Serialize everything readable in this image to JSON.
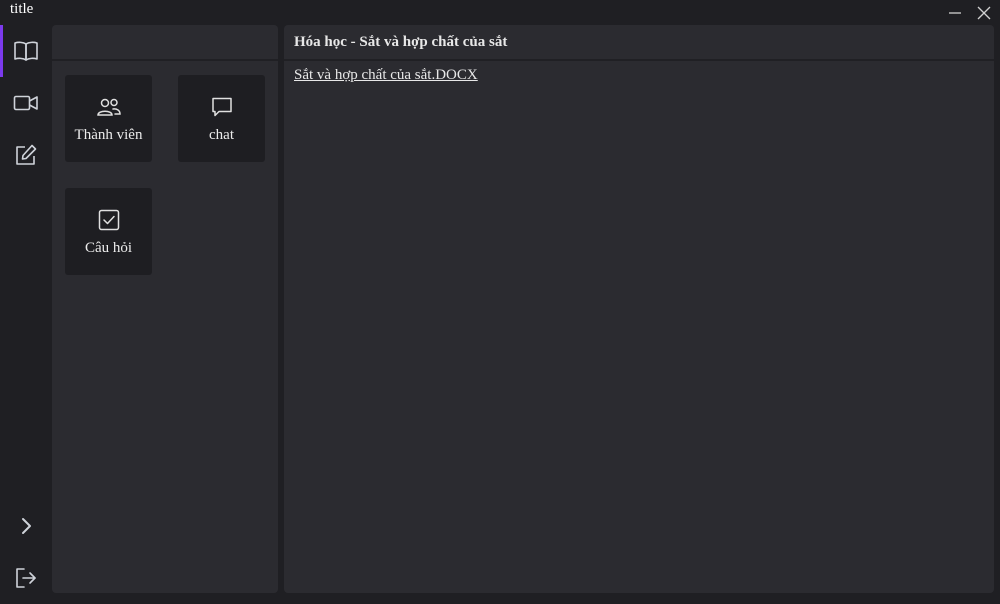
{
  "window": {
    "title": "title",
    "minimize_icon": "minimize-icon",
    "close_icon": "close-icon"
  },
  "rail": {
    "items": [
      {
        "icon": "book-icon",
        "active": true
      },
      {
        "icon": "video-icon",
        "active": false
      },
      {
        "icon": "edit-icon",
        "active": false
      }
    ],
    "bottom_items": [
      {
        "icon": "chevron-right-icon"
      },
      {
        "icon": "logout-icon"
      }
    ],
    "accent_color": "#7c3aed"
  },
  "left_panel": {
    "tiles": [
      {
        "label": "Thành viên",
        "icon": "members-icon"
      },
      {
        "label": "chat",
        "icon": "chat-icon"
      },
      {
        "label": "Câu hỏi",
        "icon": "checkbox-icon"
      }
    ]
  },
  "main": {
    "title": "Hóa học - Sắt và hợp chất của sắt",
    "file_name": "Sắt và hợp chất của sắt.DOCX"
  }
}
